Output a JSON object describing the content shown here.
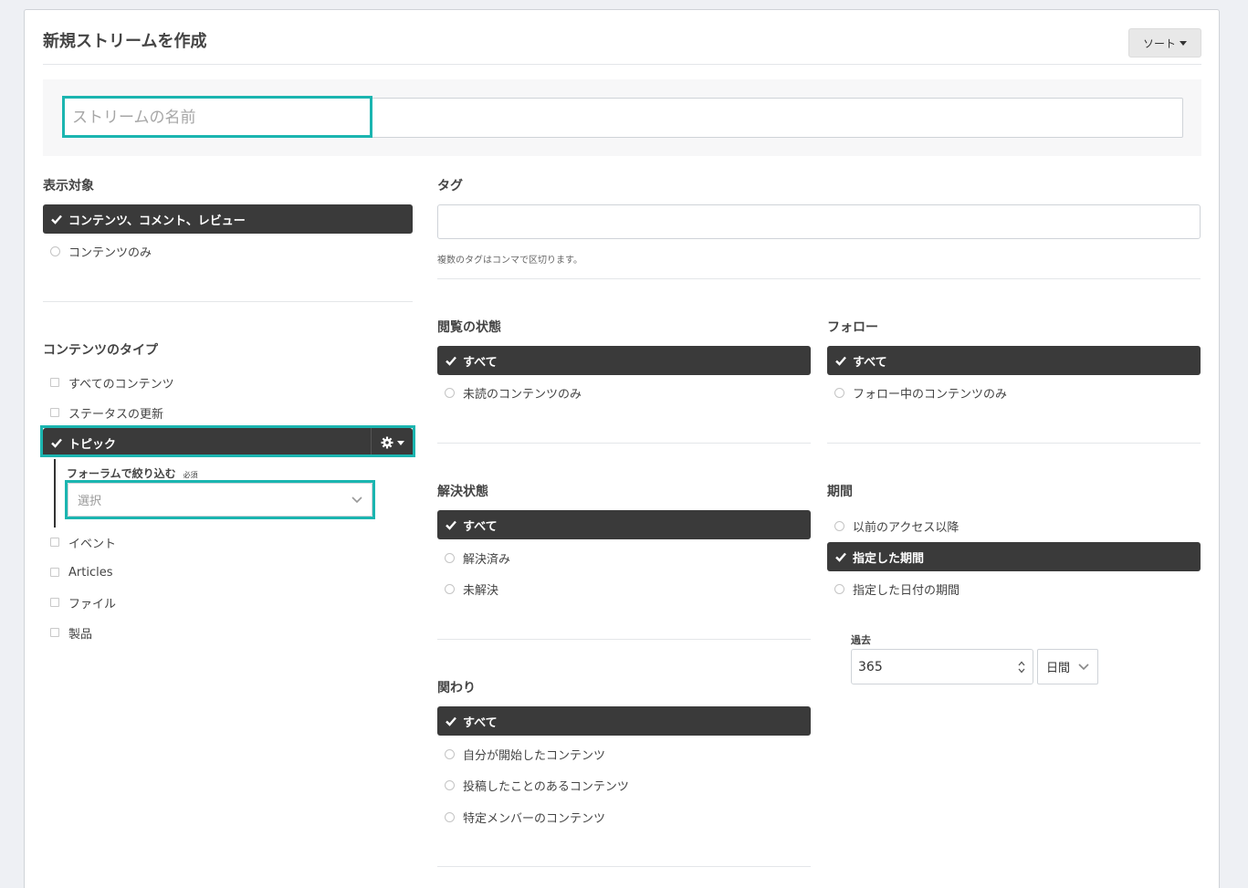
{
  "header": {
    "title": "新規ストリームを作成",
    "sort_label": "ソート"
  },
  "stream_name": {
    "placeholder": "ストリームの名前",
    "value": ""
  },
  "display_target": {
    "label": "表示対象",
    "options": [
      {
        "label": "コンテンツ、コメント、レビュー",
        "selected": true
      },
      {
        "label": "コンテンツのみ",
        "selected": false
      }
    ]
  },
  "content_type": {
    "label": "コンテンツのタイプ",
    "items": [
      {
        "label": "すべてのコンテンツ",
        "checked": false
      },
      {
        "label": "ステータスの更新",
        "checked": false
      },
      {
        "label": "トピック",
        "checked": true
      },
      {
        "label": "イベント",
        "checked": false
      },
      {
        "label": "Articles",
        "checked": false
      },
      {
        "label": "ファイル",
        "checked": false
      },
      {
        "label": "製品",
        "checked": false
      }
    ],
    "forum_filter": {
      "label": "フォーラムで絞り込む",
      "required": "必須",
      "placeholder": "選択"
    }
  },
  "tags": {
    "label": "タグ",
    "value": "",
    "help": "複数のタグはコンマで区切ります。"
  },
  "read_state": {
    "label": "閲覧の状態",
    "options": [
      {
        "label": "すべて",
        "selected": true
      },
      {
        "label": "未読のコンテンツのみ",
        "selected": false
      }
    ]
  },
  "follow": {
    "label": "フォロー",
    "options": [
      {
        "label": "すべて",
        "selected": true
      },
      {
        "label": "フォロー中のコンテンツのみ",
        "selected": false
      }
    ]
  },
  "resolution": {
    "label": "解決状態",
    "options": [
      {
        "label": "すべて",
        "selected": true
      },
      {
        "label": "解決済み",
        "selected": false
      },
      {
        "label": "未解決",
        "selected": false
      }
    ]
  },
  "period": {
    "label": "期間",
    "options": [
      {
        "label": "以前のアクセス以降",
        "selected": false
      },
      {
        "label": "指定した期間",
        "selected": true
      },
      {
        "label": "指定した日付の期間",
        "selected": false
      }
    ],
    "past": {
      "label": "過去",
      "value": "365",
      "unit": "日間"
    }
  },
  "involvement": {
    "label": "関わり",
    "options": [
      {
        "label": "すべて",
        "selected": true
      },
      {
        "label": "自分が開始したコンテンツ",
        "selected": false
      },
      {
        "label": "投稿したことのあるコンテンツ",
        "selected": false
      },
      {
        "label": "特定メンバーのコンテンツ",
        "selected": false
      }
    ]
  },
  "colors": {
    "accent_highlight": "#1bb5b0",
    "selected_bg": "#3a3a3a"
  }
}
